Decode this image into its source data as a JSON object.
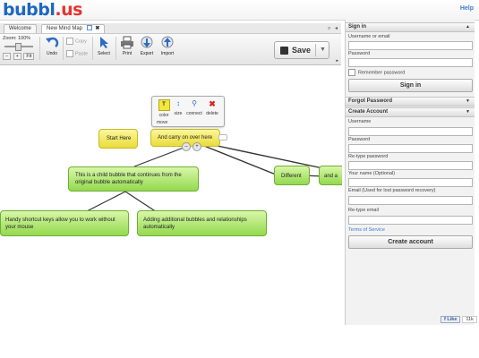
{
  "header": {
    "logo_b": "bubbl",
    "logo_dot": ".",
    "logo_us": "us",
    "help": "Help"
  },
  "tabs": [
    {
      "label": "Welcome"
    },
    {
      "label": "New Mind Map"
    }
  ],
  "toolbar": {
    "zoom_label": "Zoom: 100%",
    "zoom_minus": "–",
    "zoom_plus": "+",
    "zoom_fit": "Fit",
    "undo": "Undo",
    "copy": "Copy",
    "paste": "Paste",
    "select": "Select",
    "print": "Print",
    "export": "Export",
    "import": "Import",
    "save": "Save"
  },
  "popup_menu": {
    "color": "color",
    "size": "size",
    "connect": "connect",
    "delete": "delete",
    "move": "move"
  },
  "bubbles": [
    {
      "text": "Start Here"
    },
    {
      "text": "And carry on over here"
    },
    {
      "text": "This is a child bubble that continues from the original bubble automatically"
    },
    {
      "text": "Handy shortcut keys allow you to work without your mouse"
    },
    {
      "text": "Adding additional bubbles and relationships automatically"
    },
    {
      "text": "Different"
    },
    {
      "text": "and a"
    }
  ],
  "sidebar": {
    "signin": {
      "title": "Sign in",
      "username_label": "Username or email",
      "password_label": "Password",
      "remember": "Remember password",
      "button": "Sign in"
    },
    "forgot": {
      "title": "Forgot Password"
    },
    "create": {
      "title": "Create Account",
      "username_label": "Username",
      "password_label": "Password",
      "retype_password_label": "Re-type password",
      "name_label": "Your name (Optional)",
      "email_label": "Email (Used for lost password recovery)",
      "retype_email_label": "Re-type email",
      "terms": "Terms of Service",
      "button": "Create account"
    }
  },
  "facebook": {
    "like": "Like",
    "count": "11k"
  },
  "colors": {
    "logo_blue": "#1d67c4",
    "logo_red": "#e8332e",
    "bubble_yellow": "#f3ea5f",
    "bubble_green": "#a6e060"
  }
}
